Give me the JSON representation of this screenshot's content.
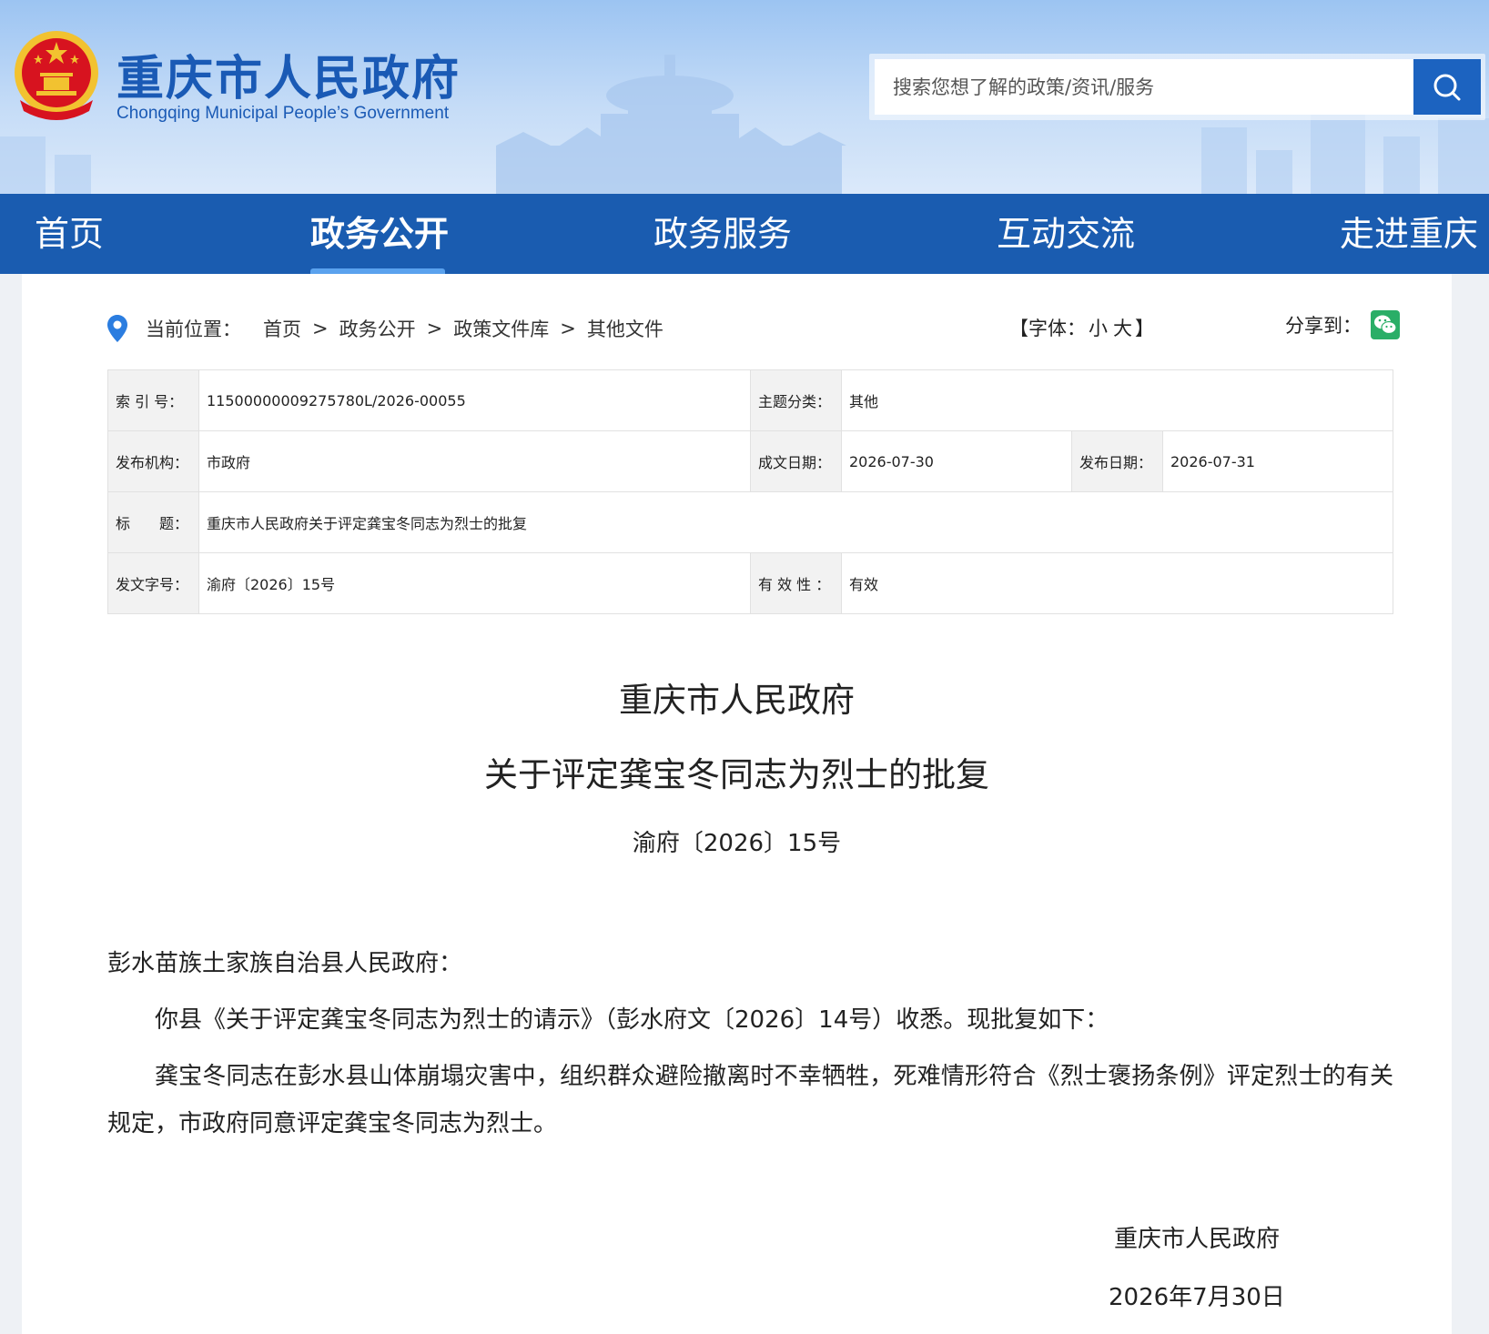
{
  "header": {
    "site_title": "重庆市人民政府",
    "site_subtitle": "Chongqing Municipal People’s Government",
    "search_placeholder": "搜索您想了解的政策/资讯/服务"
  },
  "nav": {
    "items": [
      {
        "label": "首页"
      },
      {
        "label": "政务公开"
      },
      {
        "label": "政务服务"
      },
      {
        "label": "互动交流"
      },
      {
        "label": "走进重庆"
      }
    ],
    "active_index": 1
  },
  "breadcrumb": {
    "label": "当前位置：",
    "items": [
      "首页",
      "政务公开",
      "政策文件库",
      "其他文件"
    ],
    "separator": ">"
  },
  "font_size_control": {
    "open": "【字体：",
    "small": "小",
    "large": "大",
    "close": "】"
  },
  "share": {
    "label": "分享到："
  },
  "meta": {
    "index_label": "索 引 号：",
    "index_value": "11500000009275780L/2026-00055",
    "topic_label": "主题分类：",
    "topic_value": "其他",
    "issuer_label": "发布机构：",
    "issuer_value": "市政府",
    "written_label": "成文日期：",
    "written_value": "2026-07-30",
    "publish_label": "发布日期：",
    "publish_value": "2026-07-31",
    "title_label": "标　　题：",
    "title_value": "重庆市人民政府关于评定龚宝冬同志为烈士的批复",
    "docno_label": "发文字号：",
    "docno_value": "渝府〔2026〕15号",
    "validity_label": "有 效 性 ：",
    "validity_value": "有效"
  },
  "document": {
    "title_line1": "重庆市人民政府",
    "title_line2": "关于评定龚宝冬同志为烈士的批复",
    "doc_number": "渝府〔2026〕15号",
    "addressee": "彭水苗族土家族自治县人民政府：",
    "paragraph1": "你县《关于评定龚宝冬同志为烈士的请示》（彭水府文〔2026〕14号）收悉。现批复如下：",
    "paragraph2": "龚宝冬同志在彭水县山体崩塌灾害中，组织群众避险撤离时不幸牺牲，死难情形符合《烈士褒扬条例》评定烈士的有关规定，市政府同意评定龚宝冬同志为烈士。",
    "signature_org": "重庆市人民政府",
    "signature_date": "2026年7月30日"
  },
  "colors": {
    "brand_blue": "#1a5cb0",
    "title_blue": "#1a5ab5",
    "emblem_red": "#d7131f",
    "emblem_gold": "#f2c230",
    "wechat_green": "#2aae67"
  },
  "icons": {
    "search": "search-icon",
    "location": "location-pin-icon",
    "wechat": "wechat-icon",
    "emblem": "national-emblem-icon"
  }
}
